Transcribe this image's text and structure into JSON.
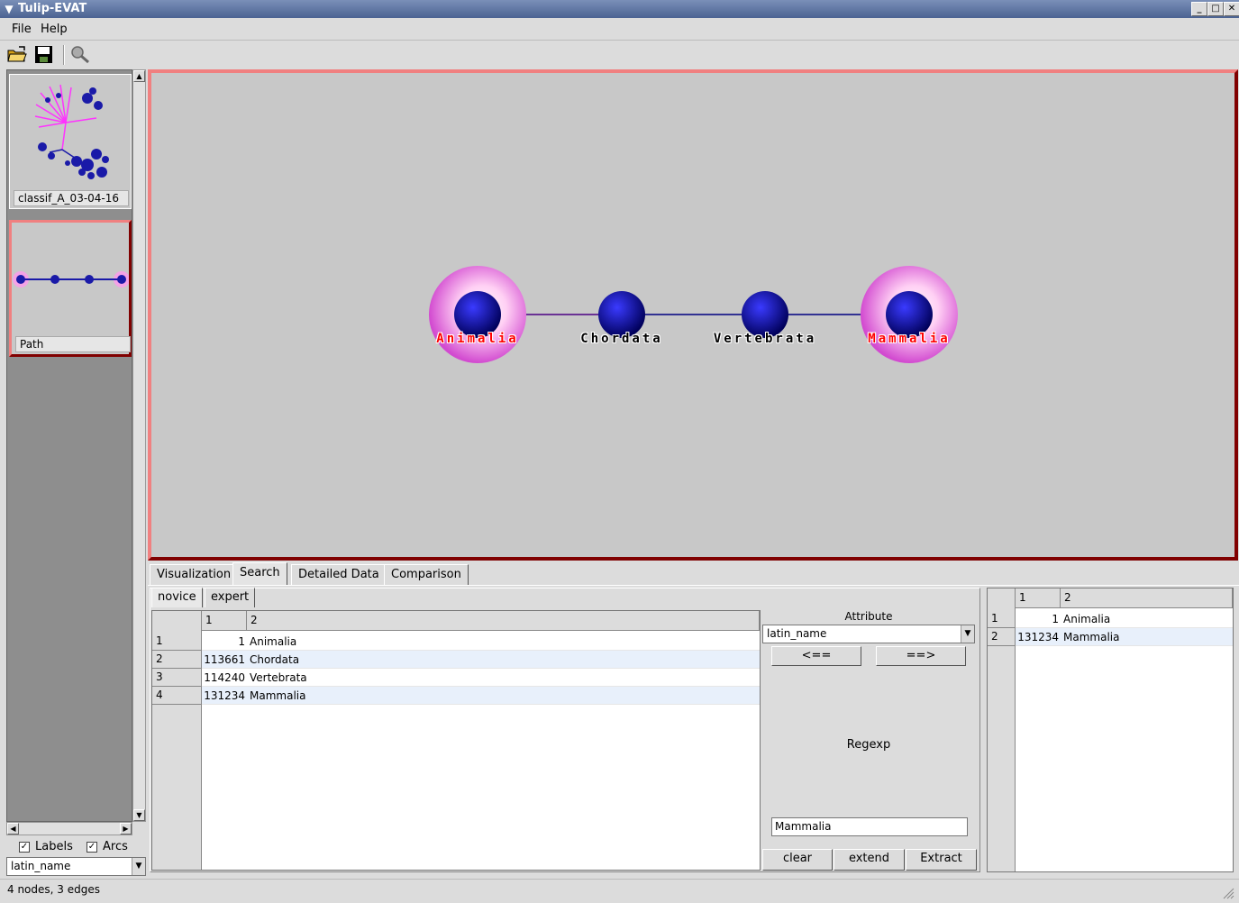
{
  "window": {
    "title": "Tulip-EVAT"
  },
  "menu": {
    "file": "File",
    "help": "Help"
  },
  "toolbar": {
    "open": "open-folder-icon",
    "save": "save-disk-icon",
    "search": "magnifier-icon"
  },
  "left": {
    "thumbnails": [
      {
        "label": "classif_A_03-04-16"
      },
      {
        "label": "Path"
      }
    ],
    "labels_checkbox": "Labels",
    "arcs_checkbox": "Arcs",
    "property_select": "latin_name"
  },
  "graph": {
    "nodes": [
      {
        "label": "Animalia",
        "highlighted": true
      },
      {
        "label": "Chordata",
        "highlighted": false
      },
      {
        "label": "Vertebrata",
        "highlighted": false
      },
      {
        "label": "Mammalia",
        "highlighted": true
      }
    ],
    "colors": {
      "node": "#00008b",
      "highlight": "#ff66cc",
      "label_highlight": "#ff0000",
      "edge": "#000080",
      "background": "#c8c8c8"
    }
  },
  "tabs": [
    "Visualization",
    "Search",
    "Detailed Data",
    "Comparison"
  ],
  "subtabs": [
    "novice",
    "expert"
  ],
  "results_table": {
    "headers": [
      "1",
      "2"
    ],
    "rows": [
      {
        "row": "1",
        "id": "1",
        "name": "Animalia"
      },
      {
        "row": "2",
        "id": "113661",
        "name": "Chordata"
      },
      {
        "row": "3",
        "id": "114240",
        "name": "Vertebrata"
      },
      {
        "row": "4",
        "id": "131234",
        "name": "Mammalia"
      }
    ]
  },
  "search_form": {
    "attribute_label": "Attribute",
    "attribute_value": "latin_name",
    "left_arrow": "<==",
    "right_arrow": "==>",
    "regexp_label": "Regexp",
    "regexp_value": "Mammalia",
    "clear": "clear",
    "extend": "extend",
    "extract": "Extract"
  },
  "selection_table": {
    "headers": [
      "1",
      "2"
    ],
    "rows": [
      {
        "row": "1",
        "id": "1",
        "name": "Animalia"
      },
      {
        "row": "2",
        "id": "131234",
        "name": "Mammalia"
      }
    ]
  },
  "status": "4 nodes, 3 edges"
}
